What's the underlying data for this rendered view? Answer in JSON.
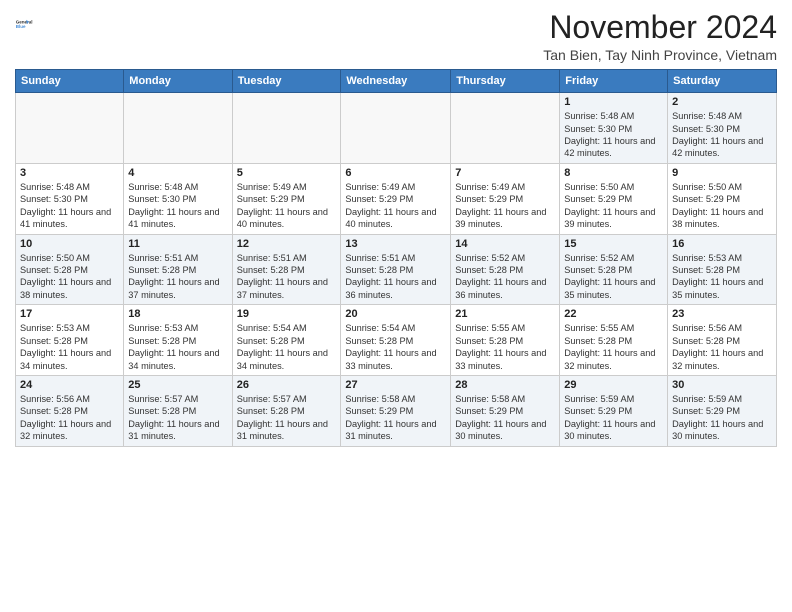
{
  "header": {
    "logo_line1": "General",
    "logo_line2": "Blue",
    "month_title": "November 2024",
    "location": "Tan Bien, Tay Ninh Province, Vietnam"
  },
  "days_of_week": [
    "Sunday",
    "Monday",
    "Tuesday",
    "Wednesday",
    "Thursday",
    "Friday",
    "Saturday"
  ],
  "weeks": [
    [
      {
        "day": "",
        "info": ""
      },
      {
        "day": "",
        "info": ""
      },
      {
        "day": "",
        "info": ""
      },
      {
        "day": "",
        "info": ""
      },
      {
        "day": "",
        "info": ""
      },
      {
        "day": "1",
        "info": "Sunrise: 5:48 AM\nSunset: 5:30 PM\nDaylight: 11 hours and 42 minutes."
      },
      {
        "day": "2",
        "info": "Sunrise: 5:48 AM\nSunset: 5:30 PM\nDaylight: 11 hours and 42 minutes."
      }
    ],
    [
      {
        "day": "3",
        "info": "Sunrise: 5:48 AM\nSunset: 5:30 PM\nDaylight: 11 hours and 41 minutes."
      },
      {
        "day": "4",
        "info": "Sunrise: 5:48 AM\nSunset: 5:30 PM\nDaylight: 11 hours and 41 minutes."
      },
      {
        "day": "5",
        "info": "Sunrise: 5:49 AM\nSunset: 5:29 PM\nDaylight: 11 hours and 40 minutes."
      },
      {
        "day": "6",
        "info": "Sunrise: 5:49 AM\nSunset: 5:29 PM\nDaylight: 11 hours and 40 minutes."
      },
      {
        "day": "7",
        "info": "Sunrise: 5:49 AM\nSunset: 5:29 PM\nDaylight: 11 hours and 39 minutes."
      },
      {
        "day": "8",
        "info": "Sunrise: 5:50 AM\nSunset: 5:29 PM\nDaylight: 11 hours and 39 minutes."
      },
      {
        "day": "9",
        "info": "Sunrise: 5:50 AM\nSunset: 5:29 PM\nDaylight: 11 hours and 38 minutes."
      }
    ],
    [
      {
        "day": "10",
        "info": "Sunrise: 5:50 AM\nSunset: 5:28 PM\nDaylight: 11 hours and 38 minutes."
      },
      {
        "day": "11",
        "info": "Sunrise: 5:51 AM\nSunset: 5:28 PM\nDaylight: 11 hours and 37 minutes."
      },
      {
        "day": "12",
        "info": "Sunrise: 5:51 AM\nSunset: 5:28 PM\nDaylight: 11 hours and 37 minutes."
      },
      {
        "day": "13",
        "info": "Sunrise: 5:51 AM\nSunset: 5:28 PM\nDaylight: 11 hours and 36 minutes."
      },
      {
        "day": "14",
        "info": "Sunrise: 5:52 AM\nSunset: 5:28 PM\nDaylight: 11 hours and 36 minutes."
      },
      {
        "day": "15",
        "info": "Sunrise: 5:52 AM\nSunset: 5:28 PM\nDaylight: 11 hours and 35 minutes."
      },
      {
        "day": "16",
        "info": "Sunrise: 5:53 AM\nSunset: 5:28 PM\nDaylight: 11 hours and 35 minutes."
      }
    ],
    [
      {
        "day": "17",
        "info": "Sunrise: 5:53 AM\nSunset: 5:28 PM\nDaylight: 11 hours and 34 minutes."
      },
      {
        "day": "18",
        "info": "Sunrise: 5:53 AM\nSunset: 5:28 PM\nDaylight: 11 hours and 34 minutes."
      },
      {
        "day": "19",
        "info": "Sunrise: 5:54 AM\nSunset: 5:28 PM\nDaylight: 11 hours and 34 minutes."
      },
      {
        "day": "20",
        "info": "Sunrise: 5:54 AM\nSunset: 5:28 PM\nDaylight: 11 hours and 33 minutes."
      },
      {
        "day": "21",
        "info": "Sunrise: 5:55 AM\nSunset: 5:28 PM\nDaylight: 11 hours and 33 minutes."
      },
      {
        "day": "22",
        "info": "Sunrise: 5:55 AM\nSunset: 5:28 PM\nDaylight: 11 hours and 32 minutes."
      },
      {
        "day": "23",
        "info": "Sunrise: 5:56 AM\nSunset: 5:28 PM\nDaylight: 11 hours and 32 minutes."
      }
    ],
    [
      {
        "day": "24",
        "info": "Sunrise: 5:56 AM\nSunset: 5:28 PM\nDaylight: 11 hours and 32 minutes."
      },
      {
        "day": "25",
        "info": "Sunrise: 5:57 AM\nSunset: 5:28 PM\nDaylight: 11 hours and 31 minutes."
      },
      {
        "day": "26",
        "info": "Sunrise: 5:57 AM\nSunset: 5:28 PM\nDaylight: 11 hours and 31 minutes."
      },
      {
        "day": "27",
        "info": "Sunrise: 5:58 AM\nSunset: 5:29 PM\nDaylight: 11 hours and 31 minutes."
      },
      {
        "day": "28",
        "info": "Sunrise: 5:58 AM\nSunset: 5:29 PM\nDaylight: 11 hours and 30 minutes."
      },
      {
        "day": "29",
        "info": "Sunrise: 5:59 AM\nSunset: 5:29 PM\nDaylight: 11 hours and 30 minutes."
      },
      {
        "day": "30",
        "info": "Sunrise: 5:59 AM\nSunset: 5:29 PM\nDaylight: 11 hours and 30 minutes."
      }
    ]
  ]
}
